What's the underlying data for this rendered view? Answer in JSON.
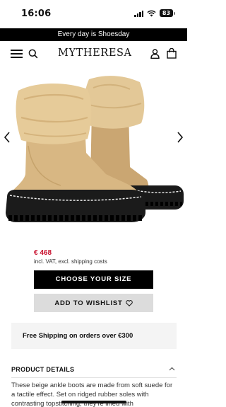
{
  "status_bar": {
    "time": "16:06",
    "battery": "83"
  },
  "promo_banner": {
    "text": "Every day is Shoesday"
  },
  "header": {
    "brand": "MYTHERESA"
  },
  "product": {
    "price": "€ 468",
    "price_note": "incl. VAT, excl. shipping costs",
    "choose_size_label": "CHOOSE YOUR SIZE",
    "wishlist_label": "ADD TO WISHLIST"
  },
  "shipping": {
    "text": "Free Shipping on orders over €300"
  },
  "details": {
    "title": "PRODUCT DETAILS",
    "description": "These beige ankle boots are made from soft suede for a tactile effect. Set on ridged rubber soles with contrasting topstitching, they're lined with"
  },
  "icons": {
    "menu": "menu-icon",
    "search": "search-icon",
    "account": "user-icon",
    "bag": "bag-icon",
    "prev": "chevron-left-icon",
    "next": "chevron-right-icon",
    "wishlist": "heart-icon",
    "collapse": "chevron-up-icon"
  },
  "colors": {
    "price": "#c8102e",
    "banner": "#000000",
    "primary_button": "#000000",
    "secondary_button": "#dcdcdc",
    "boot": "#d9b98a"
  }
}
